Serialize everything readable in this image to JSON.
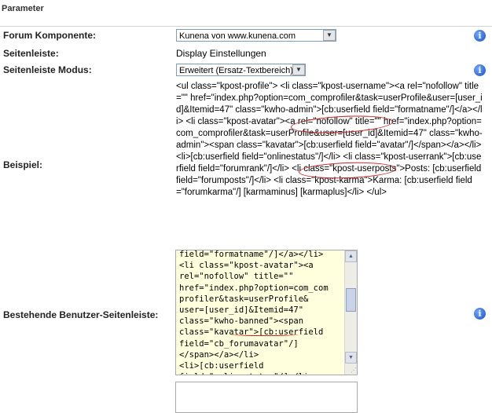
{
  "header": {
    "title": "Parameter"
  },
  "forum": {
    "label": "Forum Komponente:",
    "selected": "Kunena von www.kunena.com"
  },
  "sidebar": {
    "label": "Seitenleiste:",
    "value": "Display Einstellungen"
  },
  "sidebar_mode": {
    "label": "Seitenleiste Modus:",
    "selected": "Erweitert (Ersatz-Textbereich)"
  },
  "example": {
    "label": "Beispiel:",
    "text": "<ul class=\"kpost-profile\"> <li class=\"kpost-username\"><a rel=\"nofollow\" title=\"\" href=\"index.php?option=com_comprofiler&task=userProfile&user=[user_id]&Itemid=47\" class=\"kwho-admin\">[cb:userfield field=\"formatname\"/]</a></li> <li class=\"kpost-avatar\"><a rel=\"nofollow\" title=\"\" href=\"index.php?option=com_comprofiler&task=userProfile&user=[user_id]&Itemid=47\" class=\"kwho-admin\"><span class=\"kavatar\">[cb:userfield field=\"avatar\"/]</span></a></li> <li>[cb:userfield field=\"onlinestatus\"/]</li> <li class=\"kpost-userrank\">[cb:userfield field=\"forumrank\"/]</li> <li class=\"kpost-userposts\">Posts: [cb:userfield field=\"forumposts\"/]</li> <li class=\"kpost-karma\">Karma: [cb:userfield field=\"forumkarma\"/] [karmaminus] [karmaplus]</li> </ul>"
  },
  "existing": {
    "label": "Bestehende Benutzer-Seitenleiste:",
    "text": "field=\"formatname\"/]</a></li>\n<li class=\"kpost-avatar\"><a\nrel=\"nofollow\" title=\"\"\nhref=\"index.php?option=com_com\nprofiler&task=userProfile&\nuser=[user_id]&Itemid=47\"\nclass=\"kwho-banned\"><span\nclass=\"kavatar\">[cb:userfield\nfield=\"cb_forumavatar\"/]\n</span></a></li>\n<li>[cb:userfield\nfield=\"onlinestatus\"/]</li>"
  },
  "icons": {
    "info": "info-icon"
  },
  "colors": {
    "info_icon": "#1a4fc4",
    "textarea_bg": "#ffffdd",
    "annotation": "#cc2222"
  }
}
